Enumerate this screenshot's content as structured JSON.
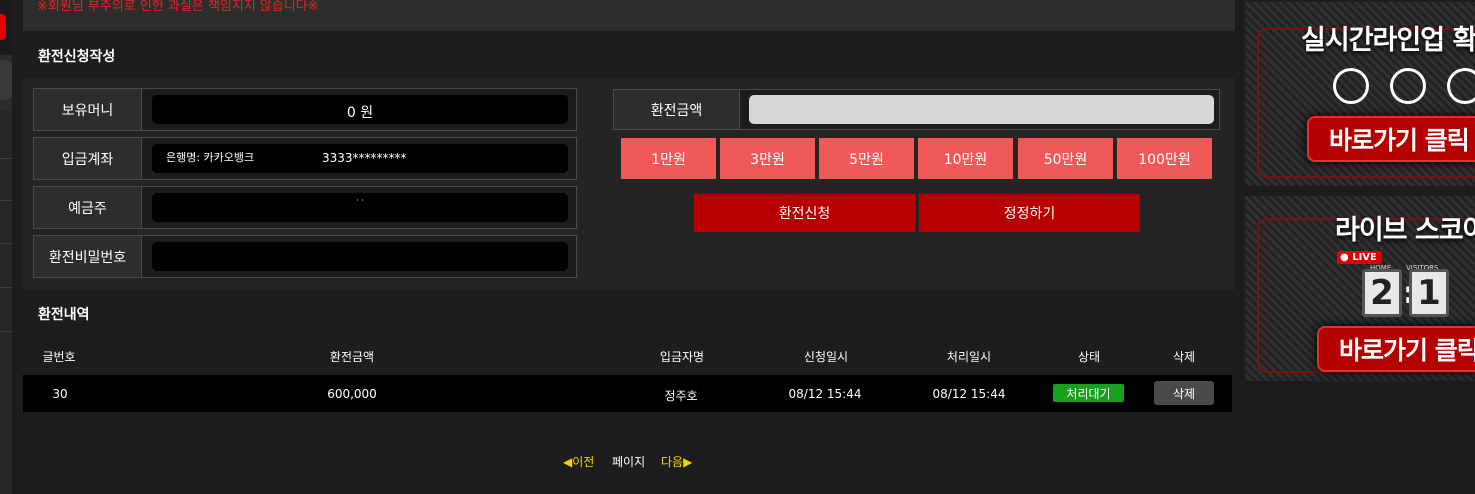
{
  "notice": "※회원님 부주의로 인한 과실은 책임지지 않습니다※",
  "form_title": "환전신청작성",
  "form": {
    "balance_label": "보유머니",
    "balance_value": "0 원",
    "account_label": "입금계좌",
    "account_bank": "은행명: 카카오뱅크",
    "account_number": "3333*********",
    "holder_label": "예금주",
    "holder_value": "· ·",
    "password_label": "환전비밀번호",
    "amount_label": "환전금액",
    "amount_value": "",
    "quick_amounts": [
      "1만원",
      "3만원",
      "5만원",
      "10만원",
      "50만원",
      "100만원"
    ],
    "submit_label": "환전신청",
    "reset_label": "정정하기"
  },
  "history_title": "환전내역",
  "history": {
    "columns": [
      "글번호",
      "환전금액",
      "입금자명",
      "신청일시",
      "처리일시",
      "상태",
      "삭제"
    ],
    "rows": [
      {
        "no": "30",
        "amount": "600,000",
        "depositor": "정주호",
        "requested": "08/12 15:44",
        "processed": "08/12 15:44",
        "status": "처리대기",
        "delete": "삭제"
      }
    ]
  },
  "pagination": {
    "prev": "◀이전",
    "page": "페이지",
    "next": "다음▶"
  },
  "banners": [
    {
      "headline": "실시간라인업 확",
      "button": "바로가기 클릭"
    },
    {
      "headline": "라이브 스코어",
      "live": "LIVE",
      "home": "HOME",
      "visitors": "VISITORS",
      "score_home": "2",
      "score_away": "1",
      "button": "바로가기 클릭"
    }
  ],
  "colors": {
    "notice_red": "#e8231e",
    "quick_button": "#f0585a",
    "action_button": "#b80000",
    "status_green": "#17a11e",
    "pager_yellow": "#f2d200"
  }
}
